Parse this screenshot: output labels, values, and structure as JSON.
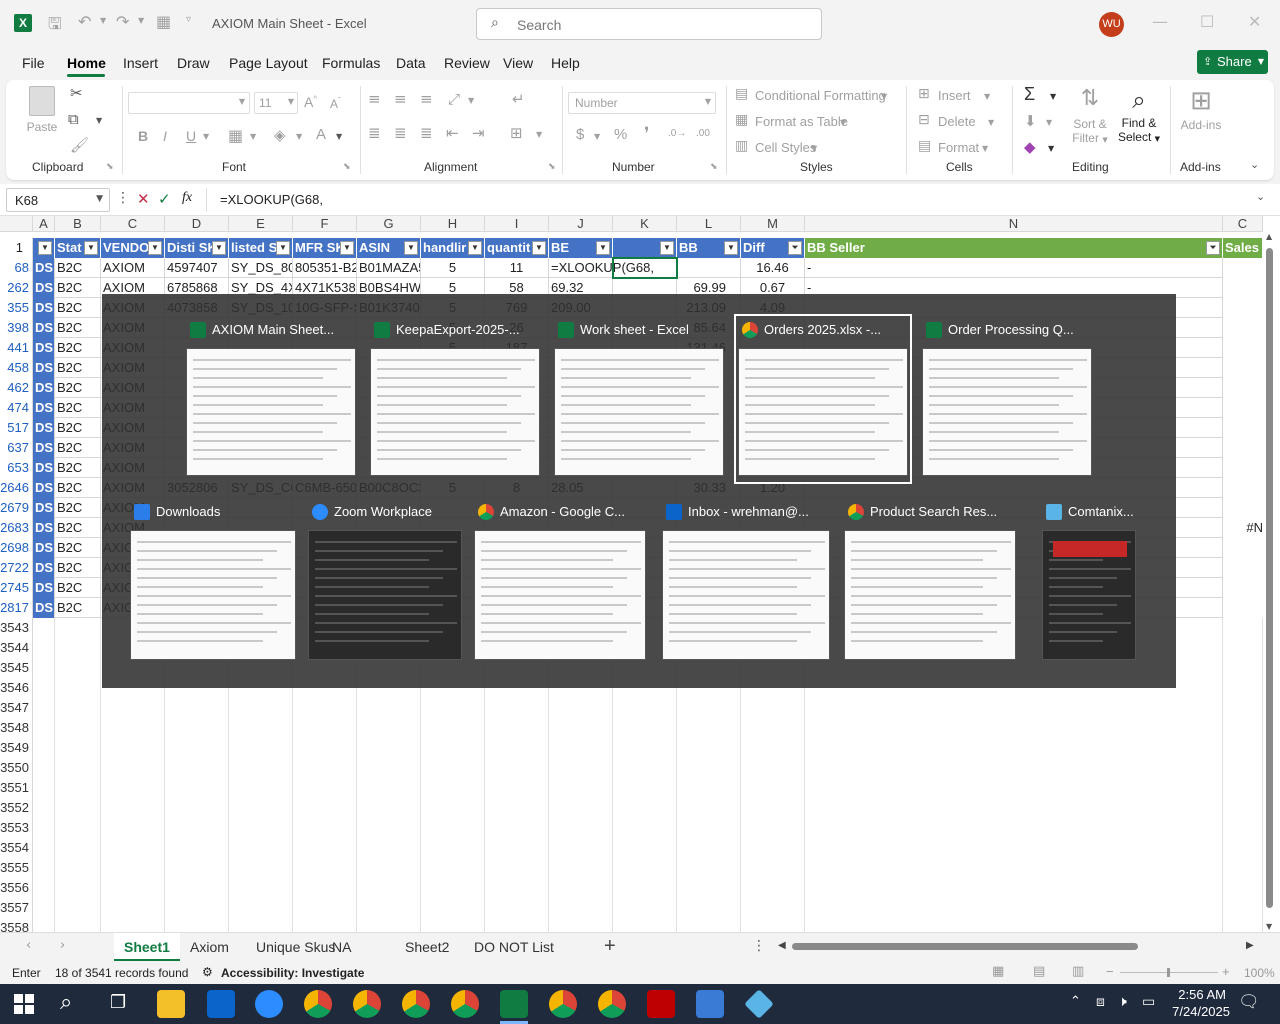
{
  "titlebar": {
    "title": "AXIOM Main Sheet  -  Excel",
    "search_placeholder": "Search",
    "user_initials": "WU"
  },
  "menu": [
    "File",
    "Home",
    "Insert",
    "Draw",
    "Page Layout",
    "Formulas",
    "Data",
    "Review",
    "View",
    "Help"
  ],
  "share_label": "Share",
  "ribbon": {
    "clipboard": {
      "label": "Clipboard",
      "paste": "Paste"
    },
    "font": {
      "label": "Font",
      "size": "11"
    },
    "alignment": {
      "label": "Alignment"
    },
    "number": {
      "label": "Number",
      "format": "Number"
    },
    "styles": {
      "label": "Styles",
      "items": [
        "Conditional Formatting",
        "Format as Table",
        "Cell Styles"
      ]
    },
    "cells": {
      "label": "Cells",
      "items": [
        "Insert",
        "Delete",
        "Format"
      ]
    },
    "editing": {
      "label": "Editing",
      "sort": "Sort &",
      "filter": "Filter",
      "find": "Find &",
      "select": "Select"
    },
    "addins": {
      "label": "Add-ins",
      "btn": "Add-ins"
    }
  },
  "formula_bar": {
    "name_box": "K68",
    "formula": "=XLOOKUP(G68,"
  },
  "columns": [
    "A",
    "B",
    "C",
    "D",
    "E",
    "F",
    "G",
    "H",
    "I",
    "J",
    "K",
    "L",
    "M",
    "N",
    "C"
  ],
  "headers": [
    "",
    "Stat",
    "VENDO",
    "Disti SK",
    "listed S",
    "MFR SK",
    "ASIN",
    "handlir",
    "quantit",
    "BE",
    "",
    "BB",
    "Diff",
    "BB Seller",
    "Sales"
  ],
  "rows": [
    {
      "n": "68",
      "a": "DS",
      "b": "B2C",
      "c": "AXIOM",
      "d": "4597407",
      "e": "SY_DS_805",
      "f": "805351-B2",
      "g": "B01MAZA5",
      "h": "5",
      "i": "11",
      "j": "=XLOOKUP(G68,",
      "l": "",
      "m": "16.46",
      "bb": "-"
    },
    {
      "n": "262",
      "a": "DS",
      "b": "B2C",
      "c": "AXIOM",
      "d": "6785868",
      "e": "SY_DS_4X7",
      "f": "4X71K5389",
      "g": "B0BS4HWC",
      "h": "5",
      "i": "58",
      "j": "69.32",
      "l": "69.99",
      "m": "0.67",
      "bb": "-"
    },
    {
      "n": "355",
      "a": "DS",
      "b": "B2C",
      "c": "AXIOM",
      "d": "4073858",
      "e": "SY_DS_10G",
      "f": "10G-SFP-S",
      "g": "B01K3740",
      "h": "5",
      "i": "769",
      "j": "209.00",
      "l": "213.09",
      "m": "4.09",
      "bb": ""
    },
    {
      "n": "398",
      "a": "DS",
      "b": "B2C",
      "c": "AXIOM",
      "d": "",
      "e": "",
      "f": "",
      "g": "",
      "h": "5",
      "i": "26",
      "j": "",
      "l": "85.64",
      "m": "",
      "bb": ""
    },
    {
      "n": "441",
      "a": "DS",
      "b": "B2C",
      "c": "AXIOM",
      "d": "",
      "e": "",
      "f": "",
      "g": "",
      "h": "5",
      "i": "187",
      "j": "",
      "l": "131.46",
      "m": "",
      "bb": ""
    },
    {
      "n": "458",
      "a": "DS",
      "b": "B2C",
      "c": "AXIOM",
      "d": "",
      "e": "",
      "f": "",
      "g": "",
      "h": "",
      "i": "",
      "j": "",
      "l": "",
      "m": "",
      "bb": ""
    },
    {
      "n": "462",
      "a": "DS",
      "b": "B2C",
      "c": "AXIOM",
      "d": "",
      "e": "",
      "f": "",
      "g": "",
      "h": "",
      "i": "",
      "j": "",
      "l": "",
      "m": "",
      "bb": ""
    },
    {
      "n": "474",
      "a": "DS",
      "b": "B2C",
      "c": "AXIOM",
      "d": "",
      "e": "",
      "f": "",
      "g": "",
      "h": "",
      "i": "",
      "j": "",
      "l": "",
      "m": "",
      "bb": ""
    },
    {
      "n": "517",
      "a": "DS",
      "b": "B2C",
      "c": "AXIOM",
      "d": "",
      "e": "",
      "f": "",
      "g": "",
      "h": "",
      "i": "",
      "j": "",
      "l": "",
      "m": "",
      "bb": ""
    },
    {
      "n": "637",
      "a": "DS",
      "b": "B2C",
      "c": "AXIOM",
      "d": "",
      "e": "",
      "f": "",
      "g": "",
      "h": "",
      "i": "",
      "j": "",
      "l": "",
      "m": "",
      "bb": ""
    },
    {
      "n": "653",
      "a": "DS",
      "b": "B2C",
      "c": "AXIOM",
      "d": "",
      "e": "",
      "f": "",
      "g": "",
      "h": "",
      "i": "",
      "j": "",
      "l": "",
      "m": "",
      "bb": ""
    },
    {
      "n": "2646",
      "a": "DS",
      "b": "B2C",
      "c": "AXIOM",
      "d": "3052806",
      "e": "SY_DS_C6",
      "f": "C6MB-650",
      "g": "B00C8OC2",
      "h": "5",
      "i": "8",
      "j": "28.05",
      "l": "30.33",
      "m": "1.20",
      "bb": ""
    },
    {
      "n": "2679",
      "a": "DS",
      "b": "B2C",
      "c": "AXIOM",
      "d": "",
      "e": "",
      "f": "",
      "g": "",
      "h": "",
      "i": "",
      "j": "",
      "l": "",
      "m": "",
      "bb": ""
    },
    {
      "n": "2683",
      "a": "DS",
      "b": "B2C",
      "c": "AXIOM",
      "d": "",
      "e": "",
      "f": "",
      "g": "",
      "h": "",
      "i": "",
      "j": "",
      "l": "",
      "m": "",
      "bb": "",
      "s": "#N"
    },
    {
      "n": "2698",
      "a": "DS",
      "b": "B2C",
      "c": "AXIOM",
      "d": "",
      "e": "",
      "f": "",
      "g": "",
      "h": "",
      "i": "",
      "j": "",
      "l": "",
      "m": "",
      "bb": ""
    },
    {
      "n": "2722",
      "a": "DS",
      "b": "B2C",
      "c": "AXIOM",
      "d": "",
      "e": "",
      "f": "",
      "g": "",
      "h": "",
      "i": "",
      "j": "",
      "l": "",
      "m": "",
      "bb": ""
    },
    {
      "n": "2745",
      "a": "DS",
      "b": "B2C",
      "c": "AXIOM",
      "d": "",
      "e": "",
      "f": "",
      "g": "",
      "h": "",
      "i": "",
      "j": "",
      "l": "",
      "m": "",
      "bb": ""
    },
    {
      "n": "2817",
      "a": "DS",
      "b": "B2C",
      "c": "AXIOM",
      "d": "",
      "e": "",
      "f": "",
      "g": "",
      "h": "",
      "i": "",
      "j": "",
      "l": "",
      "m": "",
      "bb": ""
    }
  ],
  "empty_rows": [
    "3543",
    "3544",
    "3545",
    "3546",
    "3547",
    "3548",
    "3549",
    "3550",
    "3551",
    "3552",
    "3553",
    "3554",
    "3555",
    "3556",
    "3557",
    "3558"
  ],
  "switcher": {
    "row1": [
      {
        "title": "AXIOM Main Sheet...",
        "app": "excel"
      },
      {
        "title": "KeepaExport-2025-...",
        "app": "excel"
      },
      {
        "title": "Work sheet - Excel",
        "app": "excel"
      },
      {
        "title": "Orders 2025.xlsx -...",
        "app": "chrome"
      },
      {
        "title": "Order Processing Q...",
        "app": "excel"
      }
    ],
    "row2": [
      {
        "title": "Downloads",
        "app": "explorer"
      },
      {
        "title": "Zoom Workplace",
        "app": "zoom"
      },
      {
        "title": "Amazon - Google C...",
        "app": "chrome"
      },
      {
        "title": "Inbox - wrehman@...",
        "app": "outlook"
      },
      {
        "title": "Product Search Res...",
        "app": "chrome"
      },
      {
        "title": "Comtanix...",
        "app": "other"
      }
    ]
  },
  "sheet_tabs": [
    "Sheet1",
    "Axiom",
    "Unique Skus",
    "NA",
    "Sheet2",
    "DO NOT List"
  ],
  "status": {
    "mode": "Enter",
    "records": "18 of 3541 records found",
    "accessibility": "Accessibility: Investigate",
    "zoom": "100%"
  },
  "taskbar": {
    "time": "2:56 AM",
    "date": "7/24/2025"
  },
  "colors": {
    "excel_green": "#1e7145",
    "header_blue": "#4472c4",
    "bb_green": "#70ad47",
    "accent": "#107c41"
  }
}
